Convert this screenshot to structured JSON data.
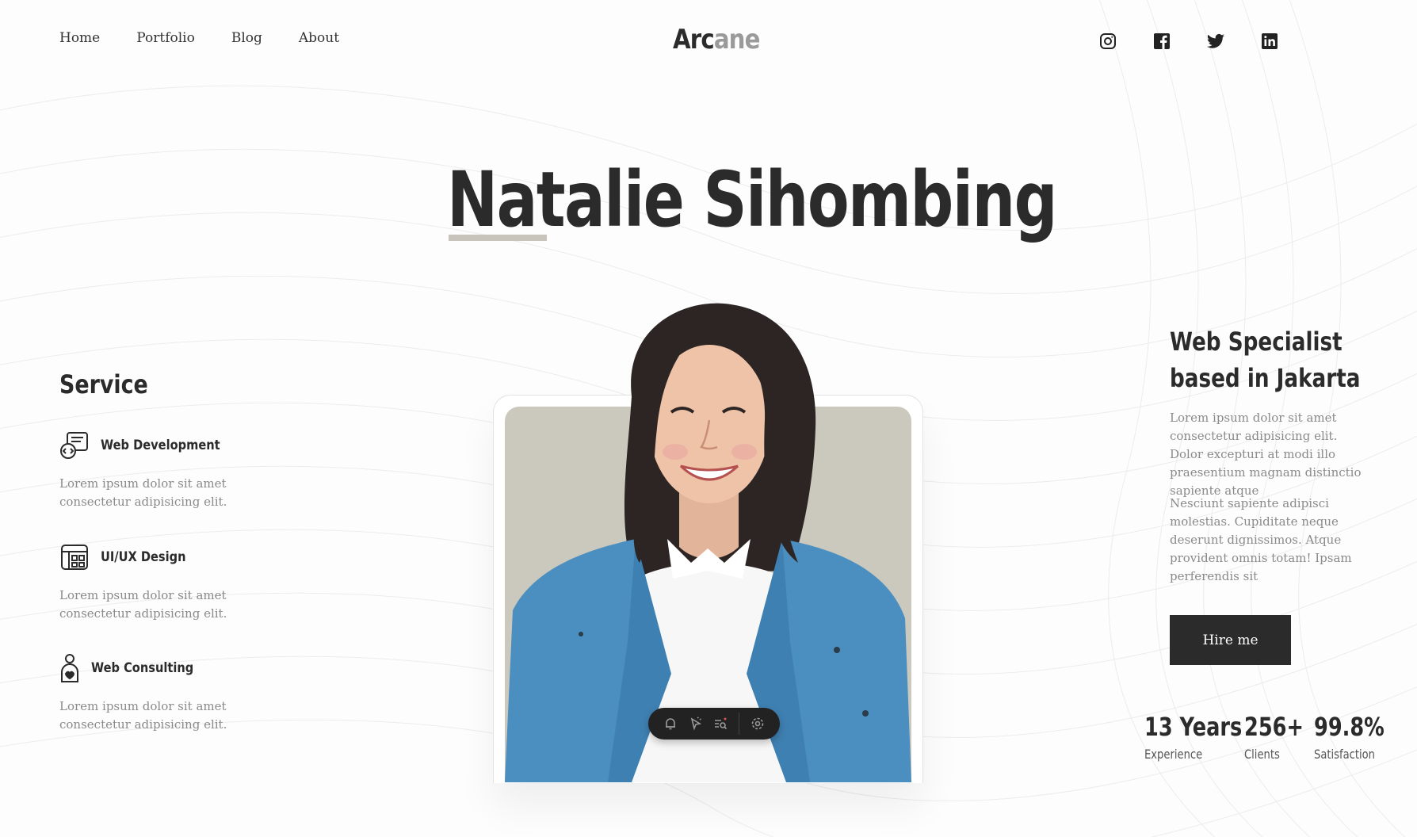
{
  "nav": {
    "items": [
      "Home",
      "Portfolio",
      "Blog",
      "About"
    ]
  },
  "logo": {
    "part1": "Arc",
    "part2": "ane"
  },
  "social": [
    "instagram-icon",
    "facebook-icon",
    "twitter-icon",
    "linkedin-icon"
  ],
  "hero": {
    "name": "Natalie Sihombing"
  },
  "service": {
    "title": "Service",
    "items": [
      {
        "name": "Web Development",
        "icon": "web-development-icon",
        "desc": "Lorem ipsum dolor sit amet consectetur adipisicing elit."
      },
      {
        "name": "UI/UX Design",
        "icon": "ui-ux-design-icon",
        "desc": "Lorem ipsum dolor sit amet consectetur adipisicing elit."
      },
      {
        "name": "Web Consulting",
        "icon": "web-consulting-icon",
        "desc": "Lorem ipsum dolor sit amet consectetur adipisicing elit."
      }
    ]
  },
  "specialist": {
    "title_line1": "Web Specialist",
    "title_line2": "based in Jakarta",
    "p1": "Lorem ipsum dolor sit amet consectetur adipisicing elit. Dolor excepturi at modi illo praesentium magnam distinctio sapiente atque",
    "p2": "Nesciunt sapiente adipisci molestias. Cupiditate neque deserunt dignissimos. Atque provident omnis totam! Ipsam perferendis sit",
    "hire_label": "Hire me"
  },
  "stats": [
    {
      "value": "13 Years",
      "label": "Experience"
    },
    {
      "value": "256+",
      "label": "Clients"
    },
    {
      "value": "99.8%",
      "label": "Satisfaction"
    }
  ],
  "toolbar": {
    "icons": [
      "bell-icon",
      "cursor-icon",
      "search-list-icon",
      "settings-icon"
    ]
  },
  "colors": {
    "primary": "#2b2b2b",
    "muted": "#8a8a8a",
    "photo_bg": "#cbc8bd",
    "accent_underline": "#c8c4bb",
    "cardigan": "#4b8ec0"
  }
}
